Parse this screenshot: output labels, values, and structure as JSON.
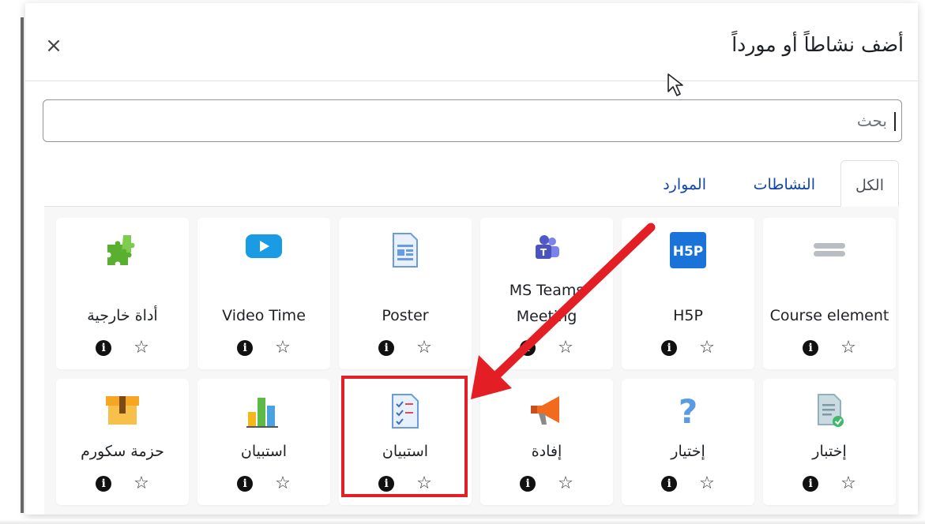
{
  "modal": {
    "title": "أضف نشاطاً أو مورداً",
    "close_label": "×"
  },
  "search": {
    "placeholder": "بحث"
  },
  "tabs": [
    {
      "label": "الكل",
      "active": true
    },
    {
      "label": "النشاطات",
      "active": false
    },
    {
      "label": "الموارد",
      "active": false
    }
  ],
  "items_row1": [
    {
      "name": "Course element",
      "icon": "course-element-icon"
    },
    {
      "name": "H5P",
      "icon": "h5p-icon"
    },
    {
      "name": "MS Teams Meeting",
      "line1": "MS Teams",
      "line2": "Meeting",
      "icon": "ms-teams-icon"
    },
    {
      "name": "Poster",
      "icon": "poster-icon"
    },
    {
      "name": "Video Time",
      "icon": "video-time-icon"
    },
    {
      "name": "أداة خارجية",
      "icon": "puzzle-icon"
    }
  ],
  "items_row2": [
    {
      "name": "إختبار",
      "icon": "quiz-icon"
    },
    {
      "name": "إختيار",
      "icon": "question-icon"
    },
    {
      "name": "إفادة",
      "icon": "megaphone-icon"
    },
    {
      "name": "استبيان",
      "icon": "survey-icon",
      "highlighted": true
    },
    {
      "name": "استبيان",
      "icon": "bar-chart-icon"
    },
    {
      "name": "حزمة سكورم",
      "icon": "package-icon"
    }
  ],
  "card_actions": {
    "info": "i",
    "star": "☆"
  },
  "colors": {
    "link": "#0f47ad",
    "highlight": "#e31e24",
    "arrow": "#e31e24",
    "grid_bg": "#f7f7f8"
  }
}
